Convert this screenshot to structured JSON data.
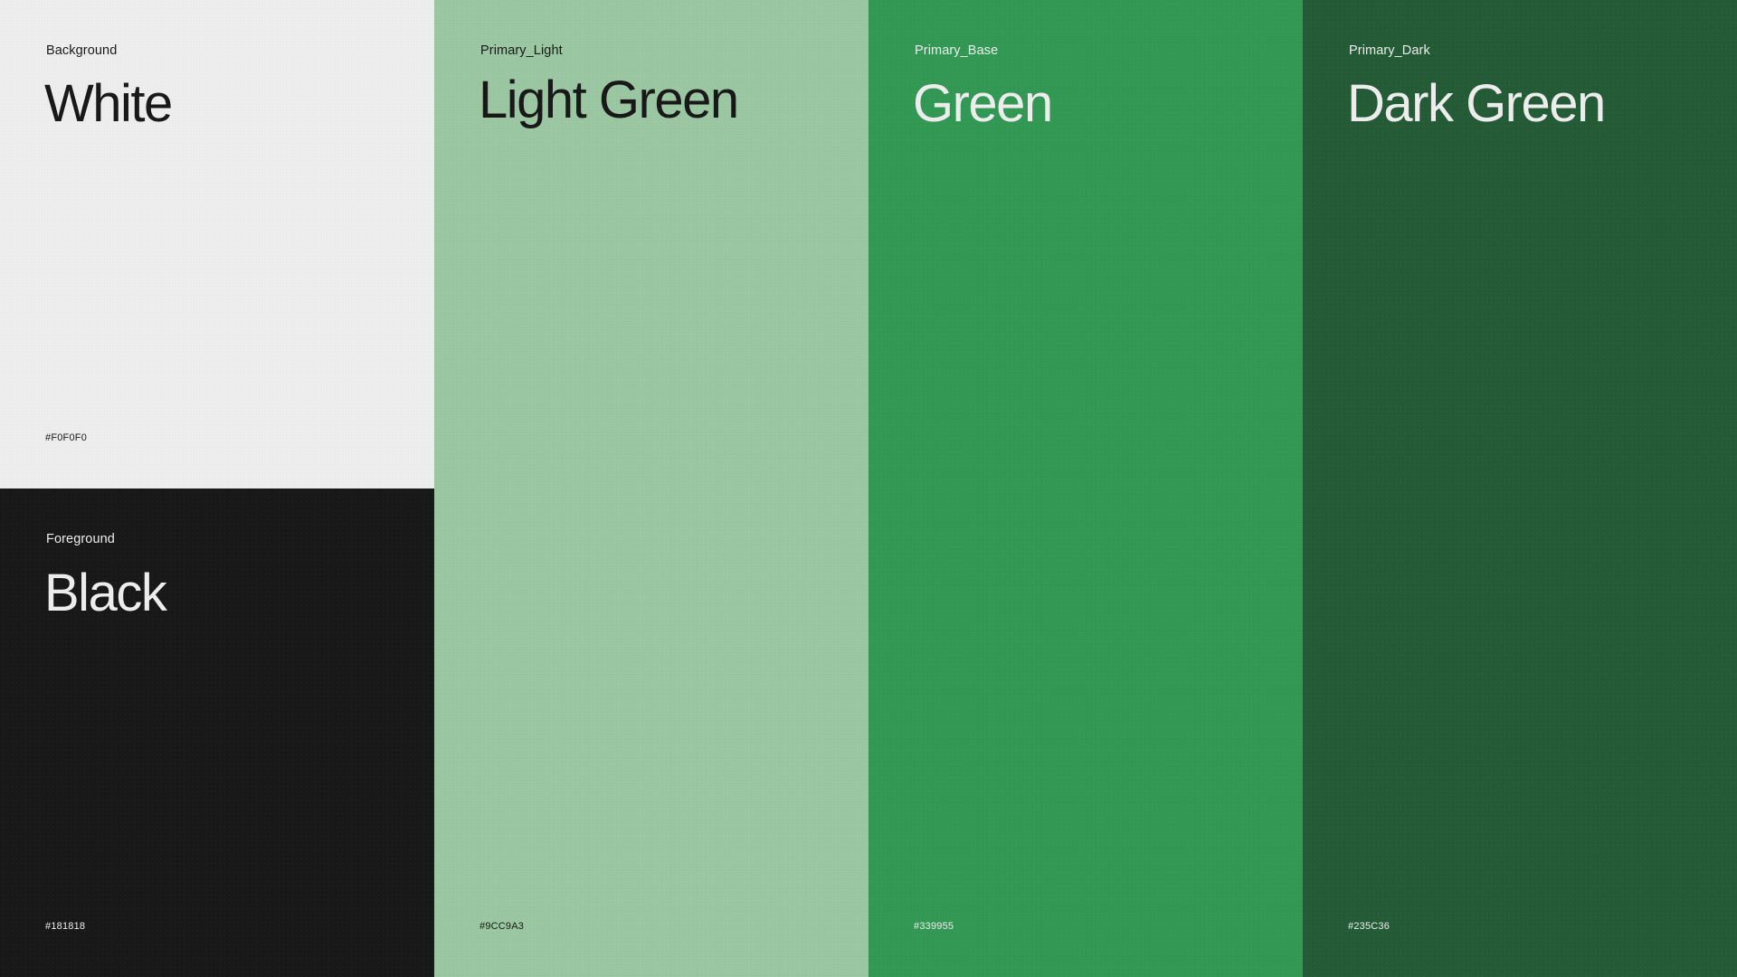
{
  "swatches": {
    "white": {
      "role": "Background",
      "name": "White",
      "hex": "#F0F0F0",
      "color": "#F0F0F0"
    },
    "black": {
      "role": "Foreground",
      "name": "Black",
      "hex": "#181818",
      "color": "#181818"
    },
    "light_green": {
      "role": "Primary_Light",
      "name": "Light Green",
      "hex": "#9CC9A3",
      "color": "#9CC9A3"
    },
    "green": {
      "role": "Primary_Base",
      "name": "Green",
      "hex": "#339955",
      "color": "#339955"
    },
    "dark_green": {
      "role": "Primary_Dark",
      "name": "Dark Green",
      "hex": "#235C36",
      "color": "#235C36"
    }
  }
}
